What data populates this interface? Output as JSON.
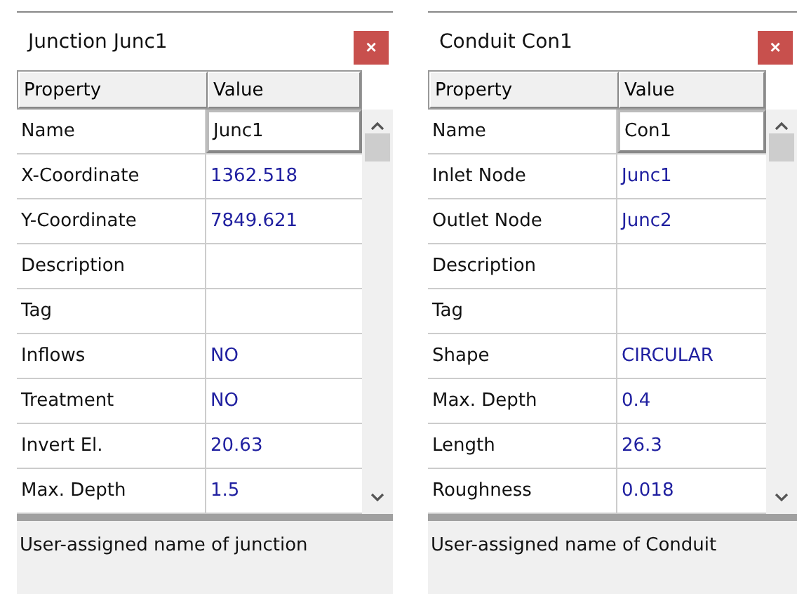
{
  "panels": [
    {
      "title": "Junction Junc1",
      "close": "×",
      "columns": [
        "Property",
        "Value"
      ],
      "rows": [
        {
          "property": "Name",
          "value": "Junc1",
          "editing": true
        },
        {
          "property": "X-Coordinate",
          "value": "1362.518",
          "editing": false
        },
        {
          "property": "Y-Coordinate",
          "value": "7849.621",
          "editing": false
        },
        {
          "property": "Description",
          "editing": false
        },
        {
          "property": "Tag",
          "editing": false
        },
        {
          "property": "Inflows",
          "value": "NO",
          "editing": false
        },
        {
          "property": "Treatment",
          "value": "NO",
          "editing": false
        },
        {
          "property": "Invert El.",
          "value": "20.63",
          "editing": false
        },
        {
          "property": "Max. Depth",
          "value": "1.5",
          "editing": false
        }
      ],
      "description": "User-assigned name of junction"
    },
    {
      "title": "Conduit Con1",
      "close": "×",
      "columns": [
        "Property",
        "Value"
      ],
      "rows": [
        {
          "property": "Name",
          "value": "Con1",
          "editing": true
        },
        {
          "property": "Inlet Node",
          "value": "Junc1",
          "editing": false
        },
        {
          "property": "Outlet Node",
          "value": "Junc2",
          "editing": false
        },
        {
          "property": "Description",
          "editing": false
        },
        {
          "property": "Tag",
          "editing": false
        },
        {
          "property": "Shape",
          "value": "CIRCULAR",
          "editing": false
        },
        {
          "property": "Max. Depth",
          "value": "0.4",
          "editing": false
        },
        {
          "property": "Length",
          "value": "26.3",
          "editing": false
        },
        {
          "property": "Roughness",
          "value": "0.018",
          "editing": false
        }
      ],
      "description": "User-assigned name of Conduit"
    }
  ]
}
